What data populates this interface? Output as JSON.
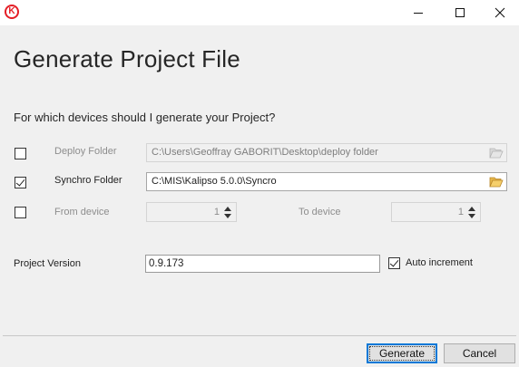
{
  "window": {
    "title": "",
    "controls": {
      "minimize": "minimize-icon",
      "maximize": "maximize-icon",
      "close": "close-icon"
    },
    "app_icon": "kalipso-logo-icon",
    "accent_color": "#e41e26"
  },
  "page": {
    "heading": "Generate Project File",
    "question": "For which devices should I generate your Project?"
  },
  "options": {
    "deploy_folder": {
      "checked": false,
      "label": "Deploy Folder",
      "value": "C:\\Users\\Geoffray GABORIT\\Desktop\\deploy folder",
      "enabled": false,
      "icon": "folder-open-icon"
    },
    "synchro_folder": {
      "checked": true,
      "label": "Synchro Folder",
      "value": "C:\\MIS\\Kalipso 5.0.0\\Syncro",
      "enabled": true,
      "icon": "folder-open-icon"
    },
    "from_device": {
      "checked": false,
      "label": "From device",
      "value": "1",
      "enabled": false
    },
    "to_device": {
      "label": "To device",
      "value": "1",
      "enabled": false
    }
  },
  "project_version": {
    "label": "Project Version",
    "value": "0.9.173",
    "auto_increment": {
      "checked": true,
      "label": "Auto increment"
    }
  },
  "buttons": {
    "generate": "Generate",
    "cancel": "Cancel"
  },
  "colors": {
    "dialog_background": "#f0f0f0",
    "default_button_border": "#0078d7"
  }
}
